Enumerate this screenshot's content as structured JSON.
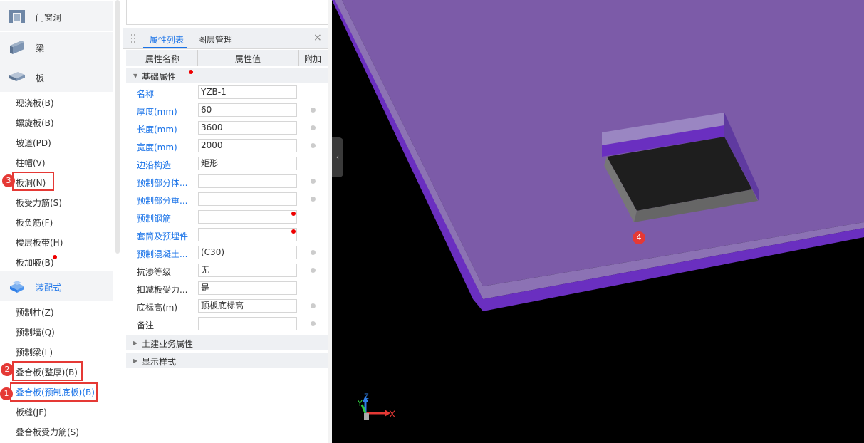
{
  "sidebar": {
    "categories": [
      {
        "label": "门窗洞",
        "icon": "door-window-icon"
      },
      {
        "label": "梁",
        "icon": "beam-icon"
      },
      {
        "label": "板",
        "icon": "slab-icon"
      },
      {
        "label": "装配式",
        "icon": "prefab-icon"
      }
    ],
    "slab_items": [
      "现浇板(B)",
      "螺旋板(B)",
      "坡道(PD)",
      "柱帽(V)",
      "板洞(N)",
      "板受力筋(S)",
      "板负筋(F)",
      "楼层板带(H)",
      "板加腋(B)"
    ],
    "prefab_items": [
      "预制柱(Z)",
      "预制墙(Q)",
      "预制梁(L)",
      "叠合板(整厚)(B)",
      "叠合板(预制底板)(B)",
      "板缝(JF)",
      "叠合板受力筋(S)"
    ]
  },
  "annotations": [
    "1",
    "2",
    "3",
    "4"
  ],
  "panel": {
    "tabs": [
      "属性列表",
      "图层管理"
    ],
    "close": "×",
    "columns": [
      "属性名称",
      "属性值",
      "附加"
    ],
    "groups": [
      "基础属性",
      "土建业务属性",
      "显示样式"
    ],
    "rows": [
      {
        "name": "名称",
        "value": "YZB-1",
        "check": false,
        "blue": true
      },
      {
        "name": "厚度(mm)",
        "value": "60",
        "check": true,
        "blue": true
      },
      {
        "name": "长度(mm)",
        "value": "3600",
        "check": true,
        "blue": true
      },
      {
        "name": "宽度(mm)",
        "value": "2000",
        "check": true,
        "blue": true
      },
      {
        "name": "边沿构造",
        "value": "矩形",
        "check": false,
        "blue": true
      },
      {
        "name": "预制部分体...",
        "value": "",
        "check": true,
        "blue": true
      },
      {
        "name": "预制部分重...",
        "value": "",
        "check": true,
        "blue": true
      },
      {
        "name": "预制钢筋",
        "value": "",
        "check": false,
        "blue": true
      },
      {
        "name": "套筒及预埋件",
        "value": "",
        "check": false,
        "blue": true
      },
      {
        "name": "预制混凝土...",
        "value": "(C30)",
        "check": true,
        "blue": true
      },
      {
        "name": "抗渗等级",
        "value": "无",
        "check": true,
        "blue": false
      },
      {
        "name": "扣减板受力...",
        "value": "是",
        "check": false,
        "blue": false
      },
      {
        "name": "底标高(m)",
        "value": "顶板底标高",
        "check": true,
        "blue": false
      },
      {
        "name": "备注",
        "value": "",
        "check": true,
        "blue": false
      }
    ]
  },
  "viewport": {
    "axes": {
      "x": "X",
      "y": "Y",
      "z": "Z"
    },
    "colors": {
      "slab_top": "#7c5ba8",
      "slab_edge": "#6a2fc0",
      "background": "#000000"
    }
  },
  "collapse_glyph": "‹"
}
